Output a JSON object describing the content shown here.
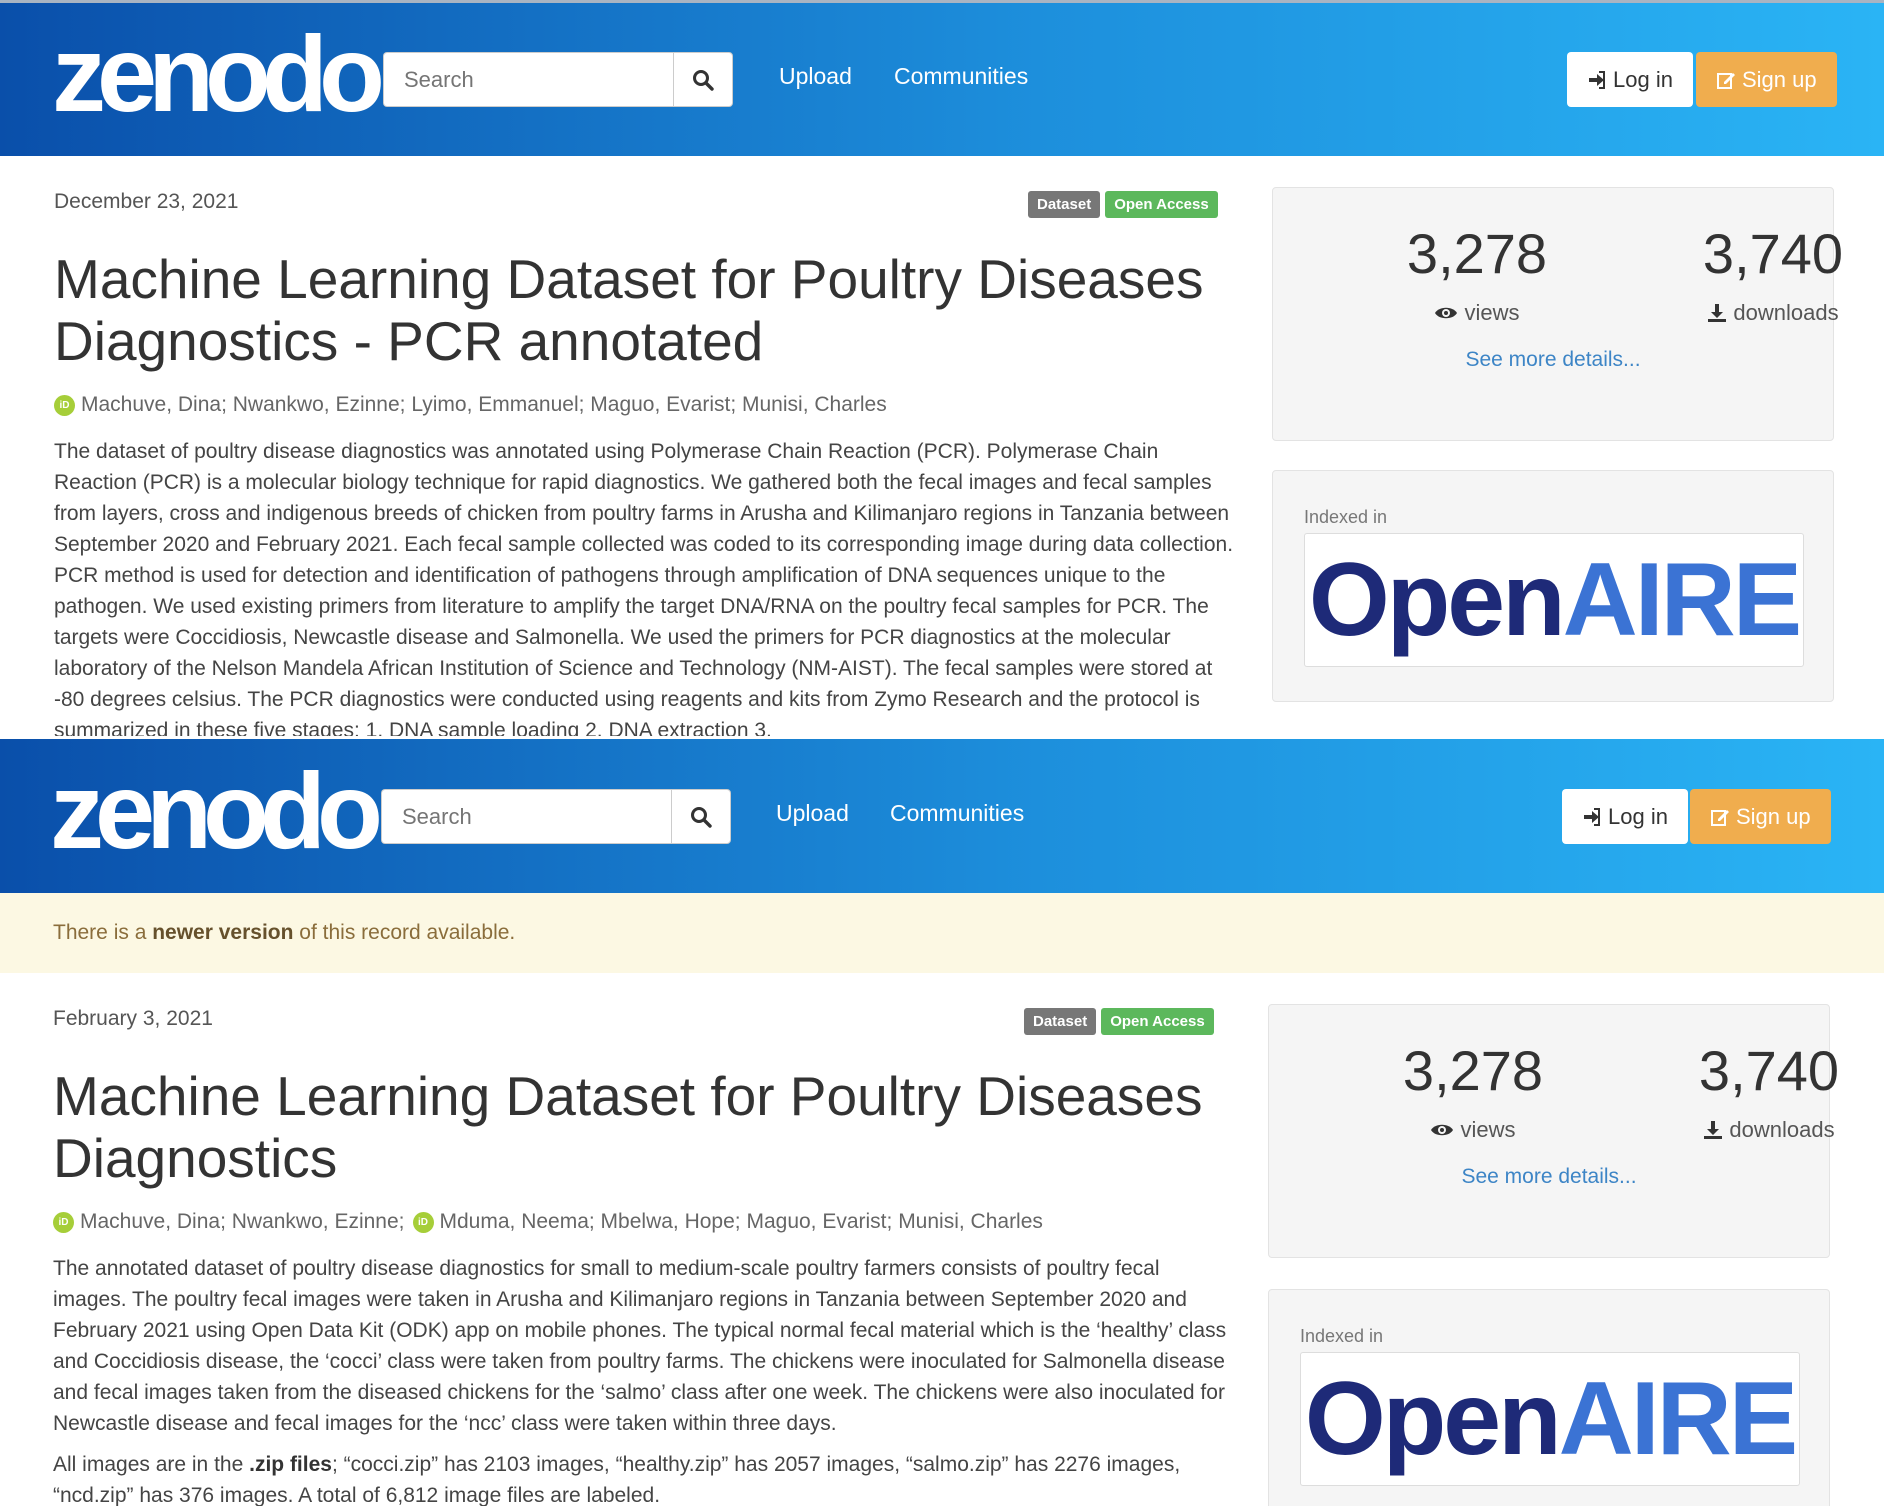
{
  "colors": {
    "navbar_start": "#0a4faa",
    "navbar_end": "#2ab4f5",
    "signup": "#f0ad4e",
    "badge_dataset": "#777777",
    "badge_open": "#5cb85c",
    "link": "#3d85c6",
    "orcid": "#a6ce39",
    "alert_bg": "#fcf8e3"
  },
  "navbar": {
    "logo": "zenodo",
    "search_placeholder": "Search",
    "search_icon": "search-icon",
    "upload": "Upload",
    "communities": "Communities",
    "login": "Log in",
    "signup": "Sign up"
  },
  "records": [
    {
      "date": "December 23, 2021",
      "badge_type": "Dataset",
      "badge_access": "Open Access",
      "title": "Machine Learning Dataset for Poultry Diseases Diagnostics - PCR annotated",
      "authors": [
        {
          "name": "Machuve, Dina",
          "orcid": true
        },
        {
          "name": "; Nwankwo, Ezinne; Lyimo, Emmanuel; Maguo, Evarist; Munisi, Charles",
          "orcid": false
        }
      ],
      "description": [
        "The dataset of poultry disease diagnostics was annotated using Polymerase Chain Reaction (PCR). Polymerase Chain Reaction (PCR) is a molecular biology technique for rapid diagnostics. We gathered both the fecal images and fecal samples from layers, cross and indigenous breeds of chicken from poultry farms in Arusha and Kilimanjaro regions in Tanzania between September 2020 and February 2021. Each fecal sample collected was coded to its corresponding image during data collection. PCR method is used for detection and identification of pathogens through amplification of DNA sequences unique to the pathogen. We used existing primers from literature to amplify the target DNA/RNA on the poultry fecal samples for PCR. The targets were Coccidiosis, Newcastle disease and Salmonella. We used the primers for PCR diagnostics at the molecular laboratory of the Nelson Mandela African Institution of Science and Technology (NM-AIST). The fecal samples were stored at -80 degrees celsius. The PCR diagnostics were conducted using reagents and kits from Zymo Research and the protocol is summarized in these five stages: 1. DNA sample loading 2. DNA extraction 3."
      ],
      "stats": {
        "views": "3,278",
        "views_label": "views",
        "downloads": "3,740",
        "downloads_label": "downloads",
        "see_more": "See more details..."
      },
      "indexed_in": "Indexed in",
      "openaire_open": "Open",
      "openaire_aire": "AIRE"
    },
    {
      "alert_prefix": "There is a",
      "alert_bold": "newer version",
      "alert_suffix": "of this record available.",
      "date": "February 3, 2021",
      "badge_type": "Dataset",
      "badge_access": "Open Access",
      "title": "Machine Learning Dataset for Poultry Diseases Diagnostics",
      "authors": [
        {
          "name": "Machuve, Dina",
          "orcid": true
        },
        {
          "name": "; Nwankwo, Ezinne;",
          "orcid": false
        },
        {
          "name": "Mduma, Neema",
          "orcid": true
        },
        {
          "name": "; Mbelwa, Hope; Maguo, Evarist; Munisi, Charles",
          "orcid": false
        }
      ],
      "description": [
        "The annotated dataset of poultry disease diagnostics for small to medium-scale poultry farmers consists of poultry fecal images. The poultry fecal images were taken in Arusha and Kilimanjaro regions in Tanzania between September 2020 and February 2021 using Open Data Kit (ODK) app on mobile phones. The typical normal fecal material which is the ‘healthy’ class and Coccidiosis disease, the ‘cocci’ class were taken from poultry farms. The chickens were inoculated for Salmonella disease and fecal images taken from the diseased chickens for the ‘salmo’ class after one week. The chickens were also inoculated for Newcastle disease and fecal images for the ‘ncc’ class were taken within three days."
      ],
      "files_prefix": "All images are in the",
      "files_bold": ".zip files",
      "files_suffix": "; “cocci.zip” has 2103 images, “healthy.zip” has 2057 images, “salmo.zip” has 2276 images, “ncd.zip” has 376 images. A total of 6,812 image files are labeled.",
      "stats": {
        "views": "3,278",
        "views_label": "views",
        "downloads": "3,740",
        "downloads_label": "downloads",
        "see_more": "See more details..."
      },
      "indexed_in": "Indexed in",
      "openaire_open": "Open",
      "openaire_aire": "AIRE"
    }
  ]
}
